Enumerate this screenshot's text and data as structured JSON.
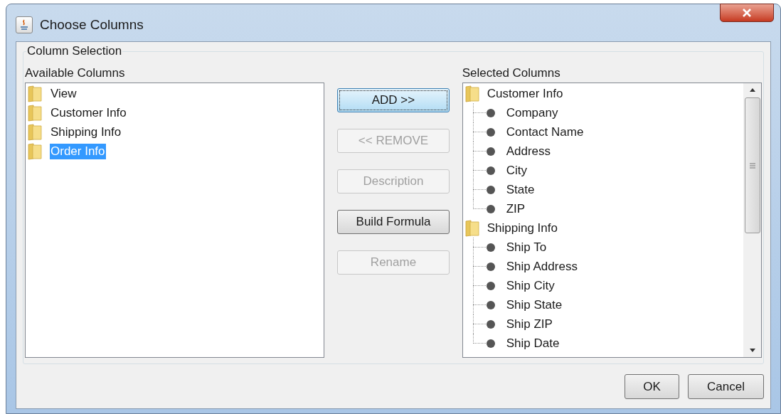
{
  "window": {
    "title": "Choose Columns"
  },
  "group": {
    "title": "Column Selection"
  },
  "available": {
    "label": "Available Columns",
    "items": [
      {
        "label": "View",
        "selected": false
      },
      {
        "label": "Customer Info",
        "selected": false
      },
      {
        "label": "Shipping Info",
        "selected": false
      },
      {
        "label": "Order Info",
        "selected": true
      }
    ]
  },
  "actions": [
    {
      "label": "ADD >>",
      "disabled": false,
      "focused": true
    },
    {
      "label": "<< REMOVE",
      "disabled": true,
      "focused": false
    },
    {
      "label": "Description",
      "disabled": true,
      "focused": false
    },
    {
      "label": "Build Formula",
      "disabled": false,
      "focused": false
    },
    {
      "label": "Rename",
      "disabled": true,
      "focused": false
    }
  ],
  "selected": {
    "label": "Selected Columns",
    "items": [
      {
        "label": "Customer Info",
        "children": [
          {
            "label": "Company"
          },
          {
            "label": "Contact Name"
          },
          {
            "label": "Address"
          },
          {
            "label": "City"
          },
          {
            "label": "State"
          },
          {
            "label": "ZIP"
          }
        ]
      },
      {
        "label": "Shipping Info",
        "children": [
          {
            "label": "Ship To"
          },
          {
            "label": "Ship Address"
          },
          {
            "label": "Ship City"
          },
          {
            "label": "Ship State"
          },
          {
            "label": "Ship ZIP"
          },
          {
            "label": "Ship Date"
          }
        ]
      }
    ]
  },
  "footer": [
    "OK",
    "Cancel"
  ]
}
